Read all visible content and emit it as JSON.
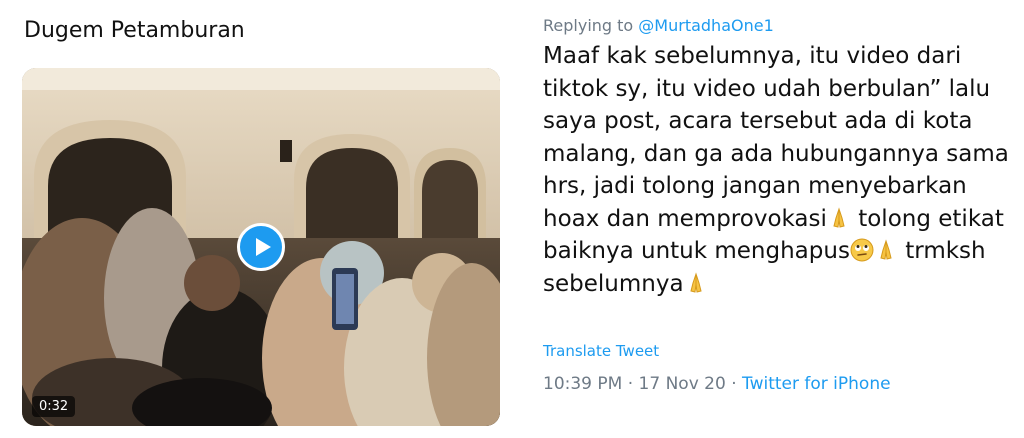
{
  "quoted_tweet": {
    "text": "Dugem Petamburan",
    "video": {
      "duration": "0:32",
      "play_icon": "play-icon"
    }
  },
  "reply": {
    "replying_label": "Replying to",
    "replying_handle": "@MurtadhaOne1",
    "lines": [
      "Maaf kak sebelumnya, itu video dari",
      "tiktok sy, itu video udah berbulan” lalu",
      "saya post, acara tersebut ada di kota",
      "malang, dan ga ada hubungannya sama",
      "hrs, jadi tolong jangan menyebarkan"
    ],
    "line6_text": "hoax dan memprovokasi",
    "line6_after": " tolong etikat",
    "line7_text": "baiknya untuk menghapus",
    "line7_after": " trmksh",
    "line8_text": "sebelumnya",
    "emojis": {
      "pray": "folded-hands-icon",
      "eye_roll": "face-rolling-eyes-icon"
    },
    "translate_label": "Translate Tweet",
    "time": "10:39 PM",
    "separator": "·",
    "date": "17 Nov 20",
    "source": "Twitter for iPhone"
  },
  "colors": {
    "link": "#1d9bf0",
    "muted": "#6e7a86",
    "text": "#111111"
  }
}
